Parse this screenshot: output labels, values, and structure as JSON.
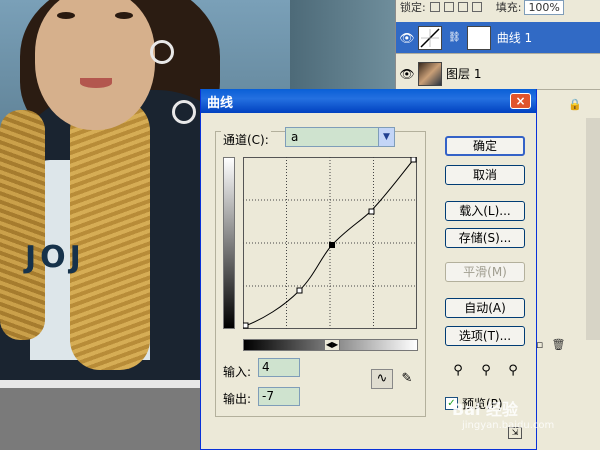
{
  "layers_panel": {
    "lock_label": "锁定:",
    "fill_label": "填充:",
    "fill_value": "100%",
    "layers": [
      {
        "name": "曲线 1",
        "selected": true,
        "type": "adjustment"
      },
      {
        "name": "图层 1",
        "selected": false,
        "type": "image"
      }
    ]
  },
  "dialog": {
    "title": "曲线",
    "close_label": "×",
    "channel_label": "通道(C):",
    "channel_value": "a",
    "input_label": "输入:",
    "input_value": "4",
    "output_label": "输出:",
    "output_value": "-7",
    "buttons": {
      "ok": "确定",
      "cancel": "取消",
      "load": "载入(L)...",
      "save": "存储(S)...",
      "smooth": "平滑(M)",
      "auto": "自动(A)",
      "options": "选项(T)..."
    },
    "preview_label": "预览(P)",
    "preview_checked": true
  },
  "photo": {
    "shirt_logo": "JOJ"
  },
  "watermark": {
    "text": "Bai 经验",
    "sub": "jingyan.baidu.com"
  },
  "colors": {
    "accent": "#316ac5",
    "title_bar": "#0a5fd6",
    "field_bg": "#cfe3cf"
  }
}
